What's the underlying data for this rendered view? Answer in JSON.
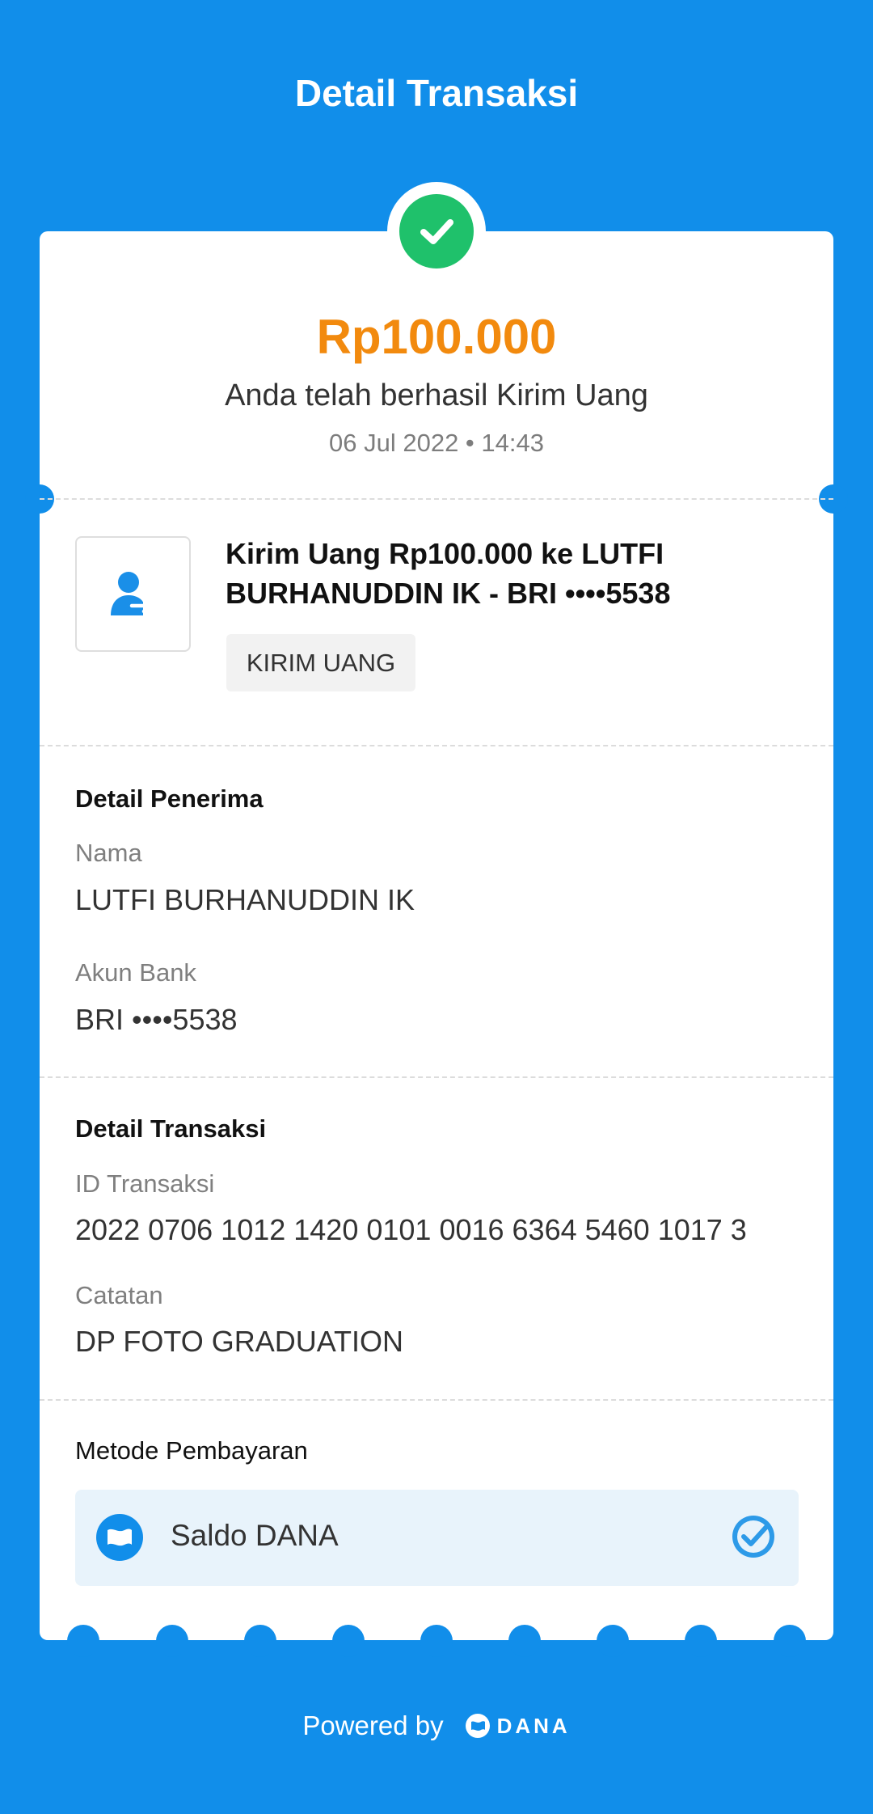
{
  "header": {
    "title": "Detail Transaksi"
  },
  "summary": {
    "amount": "Rp100.000",
    "status_text": "Anda telah berhasil Kirim Uang",
    "datetime": "06 Jul 2022 • 14:43"
  },
  "transaction": {
    "title": "Kirim Uang Rp100.000 ke LUTFI BURHANUDDIN IK - BRI ••••5538",
    "tag": "KIRIM UANG"
  },
  "recipient": {
    "section_title": "Detail Penerima",
    "name_label": "Nama",
    "name_value": "LUTFI BURHANUDDIN IK",
    "bank_label": "Akun Bank",
    "bank_value": "BRI ••••5538"
  },
  "details": {
    "section_title": "Detail Transaksi",
    "id_label": "ID Transaksi",
    "id_value": "2022 0706 1012 1420 0101 0016 6364 5460 1017 3",
    "note_label": "Catatan",
    "note_value": "DP FOTO GRADUATION"
  },
  "payment": {
    "title": "Metode Pembayaran",
    "method": "Saldo DANA"
  },
  "footer": {
    "powered_by": "Powered by",
    "brand": "DANA"
  },
  "colors": {
    "background": "#118eea",
    "amount": "#f28a0e",
    "success": "#1fc16b"
  },
  "icons": {
    "success": "check-circle-icon",
    "transaction": "send-money-icon",
    "payment": "dana-wallet-icon",
    "selected": "check-badge-icon"
  }
}
